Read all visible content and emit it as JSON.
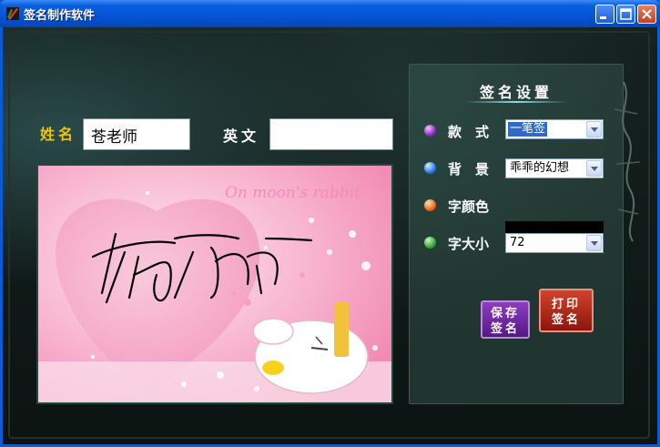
{
  "window": {
    "title": "签名制作软件"
  },
  "form": {
    "name_label": "姓名",
    "name_value": "苍老师",
    "english_label": "英文",
    "english_value": ""
  },
  "preview": {
    "watermark_text": "On moon's rabbit"
  },
  "settings": {
    "title": "签名设置",
    "style_label": "款　式",
    "style_value": "一笔签",
    "background_label": "背　景",
    "background_value": "乖乖的幻想",
    "color_label": "字颜色",
    "color_value": "#000000",
    "size_label": "字大小",
    "size_value": "72",
    "save_button": "保存签名",
    "save_line1": "保存",
    "save_line2": "签名",
    "print_button": "打印签名",
    "print_line1": "打印",
    "print_line2": "签名"
  },
  "colors": {
    "title_bar": "#0554d6",
    "name_label": "#f5c400",
    "save_button": "#6f2a9e",
    "print_button": "#b02c1a"
  }
}
